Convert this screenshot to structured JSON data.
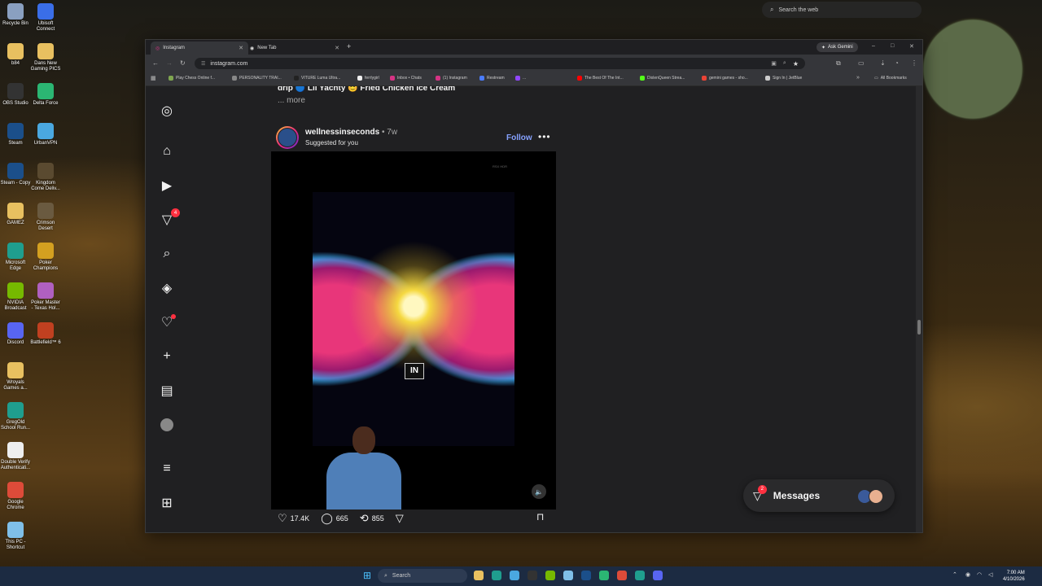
{
  "desktop": {
    "icons_left": [
      {
        "label": "Recycle Bin",
        "color": "#8aa0c0"
      },
      {
        "label": "b84",
        "color": "#e8c060"
      },
      {
        "label": "OBS Studio",
        "color": "#333333"
      },
      {
        "label": "Steam",
        "color": "#1b4f8a"
      },
      {
        "label": "Steam - Copy",
        "color": "#1b4f8a"
      },
      {
        "label": "GAMEZ",
        "color": "#e8c060"
      },
      {
        "label": "Microsoft Edge",
        "color": "#1f9e8e"
      },
      {
        "label": "NVIDIA Broadcast",
        "color": "#76b900"
      },
      {
        "label": "Discord",
        "color": "#5865f2"
      },
      {
        "label": "Wroyals Games a...",
        "color": "#e8c060"
      },
      {
        "label": "GregOld School Run...",
        "color": "#1f9e8e"
      },
      {
        "label": "Double Verify Authenticati...",
        "color": "#eeeeee"
      },
      {
        "label": "Google Chrome",
        "color": "#dd4b39"
      },
      {
        "label": "This PC - Shortcut",
        "color": "#7fbfe8"
      }
    ],
    "icons_right": [
      {
        "label": "Ubisoft Connect",
        "color": "#3a6ee8"
      },
      {
        "label": "Dans New Gaming PICS",
        "color": "#e8c060"
      },
      {
        "label": "Delta Force",
        "color": "#2bb673"
      },
      {
        "label": "UrbanVPN",
        "color": "#4aa8e0"
      },
      {
        "label": "Kingdom Come Deliv...",
        "color": "#5a4a30"
      },
      {
        "label": "Crimson Desert",
        "color": "#6a5a40"
      },
      {
        "label": "Poker Champions",
        "color": "#d4a020"
      },
      {
        "label": "Poker Master - Texas Hol...",
        "color": "#b060c0"
      },
      {
        "label": "Battlefield™ 6",
        "color": "#c04020"
      }
    ]
  },
  "web_search": {
    "placeholder": "Search the web"
  },
  "browser": {
    "tabs": [
      {
        "title": "Instagram",
        "active": true
      },
      {
        "title": "New Tab",
        "active": false
      }
    ],
    "ask_gemini": "Ask Gemini",
    "url": "instagram.com",
    "bookmarks": [
      {
        "label": "Play Chess Online f...",
        "color": "#7fa650"
      },
      {
        "label": "PERSONALITY TRAI...",
        "color": "#888888"
      },
      {
        "label": "VITURE Luma Ultra...",
        "color": "#222222"
      },
      {
        "label": "ferrlygirl",
        "color": "#eeeeee"
      },
      {
        "label": "Inbox • Chats",
        "color": "#d63384"
      },
      {
        "label": "(1) Instagram",
        "color": "#d63384"
      },
      {
        "label": "Restream",
        "color": "#4a7cff"
      },
      {
        "label": "...",
        "color": "#9147ff"
      },
      {
        "label": "The Best Of The Int...",
        "color": "#ff0000"
      },
      {
        "label": "DixlenQueen Strea...",
        "color": "#53fc18"
      },
      {
        "label": "gemini games - sho...",
        "color": "#ea4335"
      },
      {
        "label": "Sign In | JetBlue",
        "color": "#cccccc"
      }
    ],
    "all_bookmarks": "All Bookmarks"
  },
  "instagram": {
    "nav_badge": "4",
    "caption": "drip 🔵 Lil Yachty 😊 Fried Chicken Ice Cream",
    "more": "... more",
    "post": {
      "username": "wellnessinseconds",
      "time": "• 7w",
      "subtitle": "Suggested for you",
      "follow": "Follow",
      "video_overlay": "IN",
      "hdr_label": "RSX HDR",
      "likes": "17.4K",
      "comments": "665",
      "reposts": "855"
    },
    "messages": {
      "label": "Messages",
      "badge": "2"
    }
  },
  "taskbar": {
    "search": "Search",
    "time": "7:00 AM",
    "date": "4/10/2026",
    "apps": [
      "#e8c060",
      "#1f9e8e",
      "#4aa8e0",
      "#333333",
      "#76b900",
      "#7fbfe8",
      "#1b4f8a",
      "#2bb673",
      "#dd4b39",
      "#1f9e8e",
      "#5865f2"
    ]
  }
}
